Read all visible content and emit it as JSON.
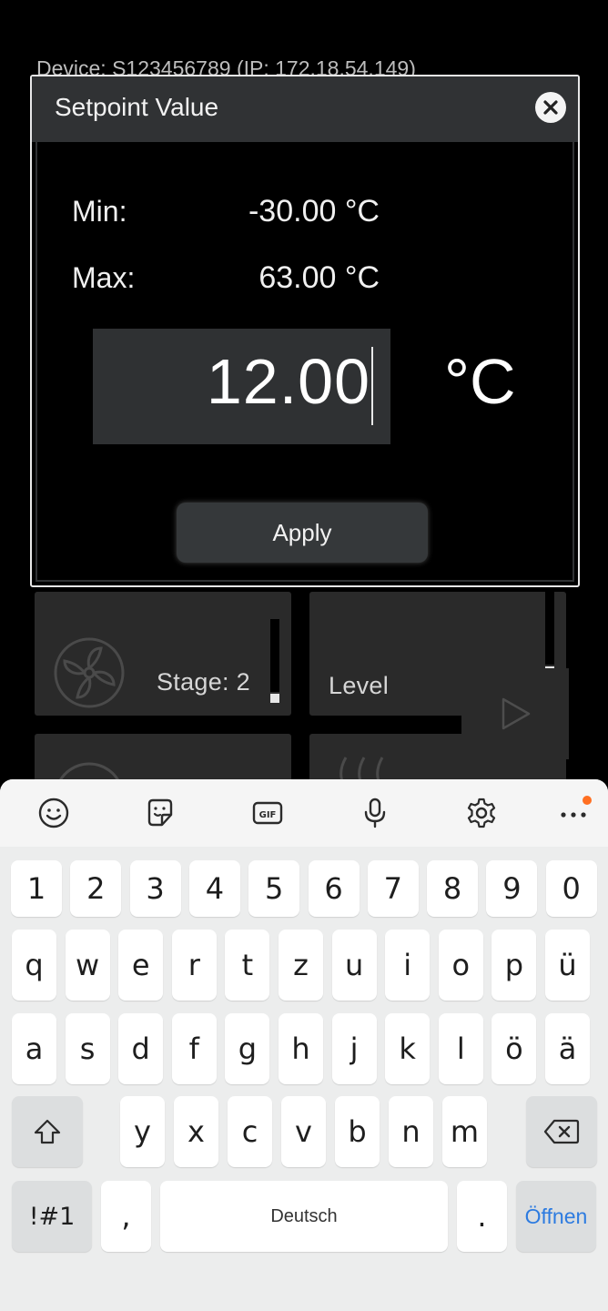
{
  "background": {
    "device_line": "Device: S123456789 (IP: 172.18.54.149)",
    "tiles": {
      "fan_stage_label": "Stage: 2",
      "level_label": "Level"
    }
  },
  "dialog": {
    "title": "Setpoint Value",
    "close_icon": "close-icon",
    "min_label": "Min:",
    "min_value": "-30.00 °C",
    "max_label": "Max:",
    "max_value": "63.00 °C",
    "input_value": "12.00",
    "unit": "°C",
    "apply_label": "Apply"
  },
  "keyboard": {
    "toolbar_icons": [
      "emoji-icon",
      "sticker-icon",
      "gif-icon",
      "microphone-icon",
      "settings-icon",
      "more-icon"
    ],
    "accent_color": "#2d7be0",
    "notification_color": "#ff6f21",
    "number_row": [
      "1",
      "2",
      "3",
      "4",
      "5",
      "6",
      "7",
      "8",
      "9",
      "0"
    ],
    "row1": [
      "q",
      "w",
      "e",
      "r",
      "t",
      "z",
      "u",
      "i",
      "o",
      "p",
      "ü"
    ],
    "row2": [
      "a",
      "s",
      "d",
      "f",
      "g",
      "h",
      "j",
      "k",
      "l",
      "ö",
      "ä"
    ],
    "row3": [
      "y",
      "x",
      "c",
      "v",
      "b",
      "n",
      "m"
    ],
    "symbols_label": "!#1",
    "comma_label": ",",
    "space_label": "Deutsch",
    "period_label": ".",
    "enter_label": "Öffnen"
  }
}
